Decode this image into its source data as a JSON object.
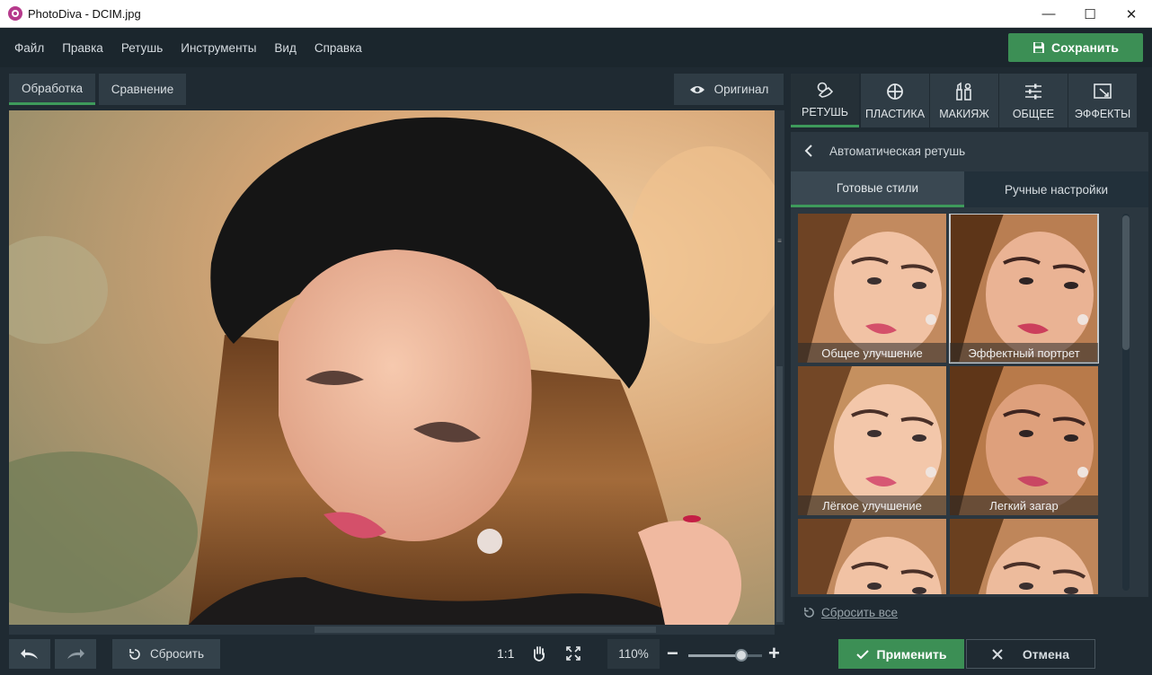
{
  "window": {
    "title": "PhotoDiva - DCIM.jpg",
    "minimize": "—",
    "maximize": "☐",
    "close": "✕"
  },
  "menu": {
    "items": [
      "Файл",
      "Правка",
      "Ретушь",
      "Инструменты",
      "Вид",
      "Справка"
    ],
    "save_label": "Сохранить"
  },
  "view": {
    "tabs": [
      "Обработка",
      "Сравнение"
    ],
    "active_tab": "Обработка",
    "original_label": "Оригинал"
  },
  "bottombar": {
    "reset_label": "Сбросить",
    "zoom_ratio": "1:1",
    "zoom_value": "110%",
    "zoom_level": 0.72
  },
  "panel": {
    "tabs": [
      "РЕТУШЬ",
      "ПЛАСТИКА",
      "МАКИЯЖ",
      "ОБЩЕЕ",
      "ЭФФЕКТЫ"
    ],
    "active_tab": "РЕТУШЬ",
    "section_title": "Автоматическая ретушь",
    "style_tabs": [
      "Готовые стили",
      "Ручные настройки"
    ],
    "active_style_tab": "Готовые стили",
    "presets": [
      "Общее улучшение",
      "Эффектный портрет",
      "Лёгкое улучшение",
      "Легкий загар",
      "",
      ""
    ],
    "selected_preset": "Эффектный портрет",
    "reset_all_label": "Сбросить все",
    "apply_label": "Применить",
    "cancel_label": "Отмена"
  },
  "colors": {
    "accent_green": "#3c8f55",
    "background": "#1f2a32",
    "panel": "#2b3740"
  }
}
